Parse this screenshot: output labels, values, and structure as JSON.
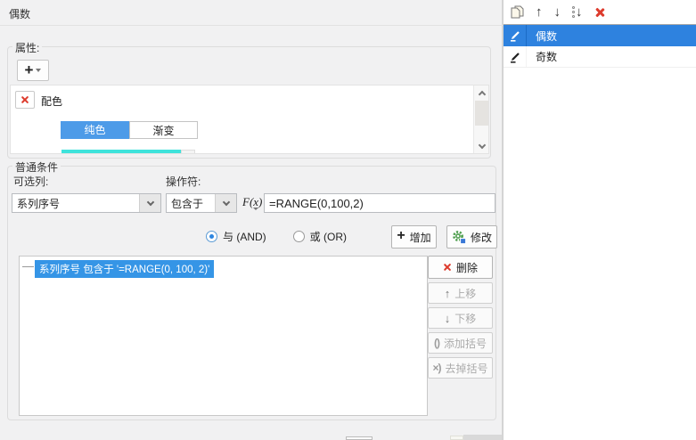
{
  "dialog": {
    "title": "偶数",
    "properties": {
      "section_label": "属性:",
      "color_item_label": "配色",
      "tabs": [
        {
          "label": "纯色"
        },
        {
          "label": "渐变"
        }
      ],
      "swatch_color": "#3FE3DB"
    },
    "conditions": {
      "section_label": "普通条件",
      "column_label": "可选列:",
      "column_selected": "系列序号",
      "operator_label": "操作符:",
      "operator_selected": "包含于",
      "fx_glyph": "F(x)",
      "formula": "=RANGE(0,100,2)",
      "logic_and_label": "与 (AND)",
      "logic_or_label": "或 (OR)",
      "add_button": "增加",
      "modify_button": "修改",
      "selected_condition": "系列序号 包含于 '=RANGE(0, 100, 2)'",
      "delete_button": "删除",
      "move_up_button": "上移",
      "move_down_button": "下移",
      "add_bracket_button": "添加括号",
      "remove_bracket_button": "去掉括号"
    }
  },
  "right_panel": {
    "items": [
      {
        "label": "偶数",
        "selected": true
      },
      {
        "label": "奇数",
        "selected": false
      }
    ]
  },
  "icons": {
    "plus": "+",
    "up_arrow": "↑",
    "down_arrow": "↓",
    "open_paren": "(",
    "close_paren": ")",
    "remove_bracket_glyph": "×)"
  },
  "colors": {
    "selection_blue": "#2E82DF",
    "tab_active_blue": "#4D9BE8",
    "condition_highlight_blue": "#3595E6",
    "danger_red": "#DD3B2D",
    "swatch_cyan": "#3FE3DB",
    "gear_green": "#4E9E4E",
    "gear_square_blue": "#3A78D6"
  }
}
